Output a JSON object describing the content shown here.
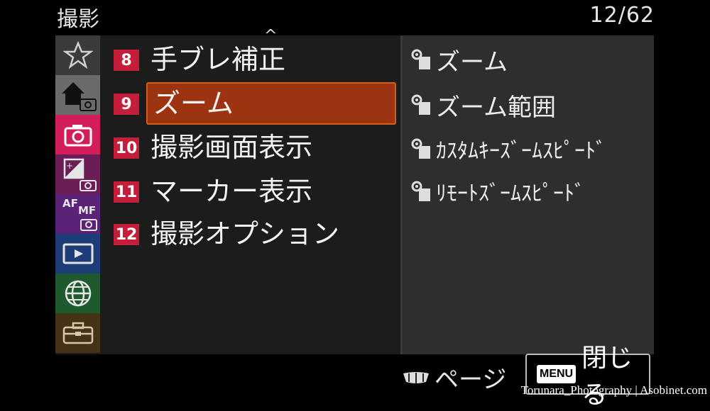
{
  "header": {
    "title": "撮影",
    "page_counter": "12/62"
  },
  "sidebar": {
    "tabs": [
      {
        "name": "favorites",
        "icon": "star-icon",
        "color": "#3a3a3a"
      },
      {
        "name": "main",
        "icon": "home-camera-icon",
        "color": "#6b6b6b"
      },
      {
        "name": "shooting",
        "icon": "camera-icon",
        "color": "#d21e5a"
      },
      {
        "name": "exposure",
        "icon": "exposure-camera-icon",
        "color": "#6b1d55"
      },
      {
        "name": "focus",
        "icon": "af-mf-camera-icon",
        "label": "AF MF",
        "color": "#5a2378"
      },
      {
        "name": "playback",
        "icon": "play-icon",
        "color": "#1e3c78"
      },
      {
        "name": "network",
        "icon": "globe-icon",
        "color": "#1e5a2d"
      },
      {
        "name": "setup",
        "icon": "toolbox-icon",
        "color": "#463214"
      }
    ]
  },
  "menu": {
    "items": [
      {
        "num": "8",
        "label": "手ブレ補正"
      },
      {
        "num": "9",
        "label": "ズーム",
        "selected": true
      },
      {
        "num": "10",
        "label": "撮影画面表示"
      },
      {
        "num": "11",
        "label": "マーカー表示"
      },
      {
        "num": "12",
        "label": "撮影オプション"
      }
    ]
  },
  "submenu": {
    "items": [
      {
        "label": "ズーム",
        "icon": "camera-settings-icon"
      },
      {
        "label": "ズーム範囲",
        "icon": "camera-settings-icon"
      },
      {
        "label": "ｶｽﾀﾑｷｰｽﾞｰﾑｽﾋﾟｰﾄﾞ",
        "icon": "camera-settings-icon"
      },
      {
        "label": "ﾘﾓｰﾄｽﾞｰﾑｽﾋﾟｰﾄﾞ",
        "icon": "camera-settings-icon"
      }
    ]
  },
  "footer": {
    "page_label": "ページ",
    "menu_badge": "MENU",
    "close_label": "閉じる"
  },
  "watermark": "Torunara_Photography | Asobinet.com",
  "colors": {
    "accent": "#9c3412",
    "number_badge": "#c41e3a"
  }
}
